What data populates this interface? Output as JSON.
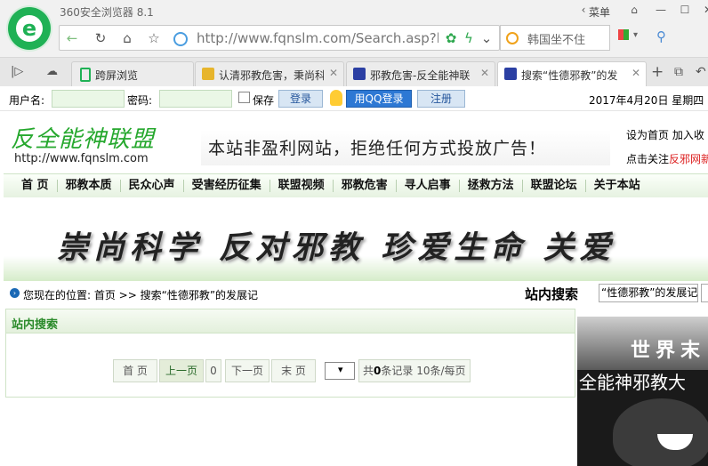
{
  "browser": {
    "app_title": "360安全浏览器 8.1",
    "menu_label": "菜单",
    "url": "http://www.fqnslm.com/Search.asp?k",
    "search_text": "韩国坐不住",
    "tabs": [
      {
        "label": "跨屏浏览",
        "icon_color": "#1fb155"
      },
      {
        "label": "认清邪教危害，秉尚科",
        "icon_color": "#e7b52c"
      },
      {
        "label": "邪教危害-反全能神联",
        "icon_color": "#2b3fa3"
      },
      {
        "label": "搜索“性德邪教”的发",
        "icon_color": "#2b3fa3"
      }
    ]
  },
  "login": {
    "username_label": "用户名:",
    "password_label": "密码:",
    "save_label": "保存",
    "login_label": "登录",
    "qq_login_label": "用QQ登录",
    "register_label": "注册",
    "date": "2017年4月20日 星期四"
  },
  "site": {
    "logo_text": "反全能神联盟",
    "url": "http://www.fqnslm.com",
    "banner": "本站非盈利网站，拒绝任何方式投放广告！",
    "links_row1": "设为首页   加入收",
    "links_row2_prefix": "点击关注",
    "links_row2_red": "反邪网新",
    "nav": [
      "首 页",
      "邪教本质",
      "民众心声",
      "受害经历征集",
      "联盟视频",
      "邪教危害",
      "寻人启事",
      "拯救方法",
      "联盟论坛",
      "关于本站"
    ],
    "slogan": "崇尚科学 反对邪教 珍爱生命 关爱"
  },
  "location": {
    "text": "您现在的位置: 首页 >> 搜索“性德邪教”的发展记",
    "search_label": "站内搜索",
    "search_value": "“性德邪教”的发展记"
  },
  "panel": {
    "title": "站内搜索",
    "first": "首 页",
    "prev": "上一页",
    "page_num": "0",
    "next": "下一页",
    "last": "末 页",
    "info_prefix": "共",
    "info_count": "0",
    "info_suffix": "条记录 10条/每页"
  },
  "ad": {
    "title": "世界末",
    "subtitle": "全能神邪教大"
  }
}
